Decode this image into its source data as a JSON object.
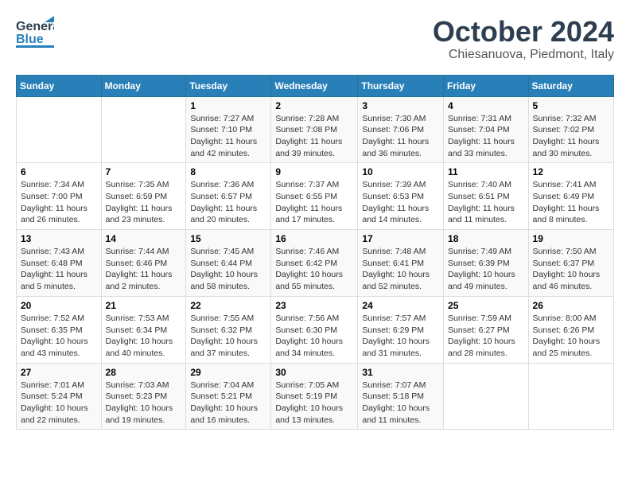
{
  "header": {
    "logo_general": "General",
    "logo_blue": "Blue",
    "month": "October 2024",
    "location": "Chiesanuova, Piedmont, Italy"
  },
  "weekdays": [
    "Sunday",
    "Monday",
    "Tuesday",
    "Wednesday",
    "Thursday",
    "Friday",
    "Saturday"
  ],
  "weeks": [
    [
      {
        "day": "",
        "sunrise": "",
        "sunset": "",
        "daylight": ""
      },
      {
        "day": "",
        "sunrise": "",
        "sunset": "",
        "daylight": ""
      },
      {
        "day": "1",
        "sunrise": "Sunrise: 7:27 AM",
        "sunset": "Sunset: 7:10 PM",
        "daylight": "Daylight: 11 hours and 42 minutes."
      },
      {
        "day": "2",
        "sunrise": "Sunrise: 7:28 AM",
        "sunset": "Sunset: 7:08 PM",
        "daylight": "Daylight: 11 hours and 39 minutes."
      },
      {
        "day": "3",
        "sunrise": "Sunrise: 7:30 AM",
        "sunset": "Sunset: 7:06 PM",
        "daylight": "Daylight: 11 hours and 36 minutes."
      },
      {
        "day": "4",
        "sunrise": "Sunrise: 7:31 AM",
        "sunset": "Sunset: 7:04 PM",
        "daylight": "Daylight: 11 hours and 33 minutes."
      },
      {
        "day": "5",
        "sunrise": "Sunrise: 7:32 AM",
        "sunset": "Sunset: 7:02 PM",
        "daylight": "Daylight: 11 hours and 30 minutes."
      }
    ],
    [
      {
        "day": "6",
        "sunrise": "Sunrise: 7:34 AM",
        "sunset": "Sunset: 7:00 PM",
        "daylight": "Daylight: 11 hours and 26 minutes."
      },
      {
        "day": "7",
        "sunrise": "Sunrise: 7:35 AM",
        "sunset": "Sunset: 6:59 PM",
        "daylight": "Daylight: 11 hours and 23 minutes."
      },
      {
        "day": "8",
        "sunrise": "Sunrise: 7:36 AM",
        "sunset": "Sunset: 6:57 PM",
        "daylight": "Daylight: 11 hours and 20 minutes."
      },
      {
        "day": "9",
        "sunrise": "Sunrise: 7:37 AM",
        "sunset": "Sunset: 6:55 PM",
        "daylight": "Daylight: 11 hours and 17 minutes."
      },
      {
        "day": "10",
        "sunrise": "Sunrise: 7:39 AM",
        "sunset": "Sunset: 6:53 PM",
        "daylight": "Daylight: 11 hours and 14 minutes."
      },
      {
        "day": "11",
        "sunrise": "Sunrise: 7:40 AM",
        "sunset": "Sunset: 6:51 PM",
        "daylight": "Daylight: 11 hours and 11 minutes."
      },
      {
        "day": "12",
        "sunrise": "Sunrise: 7:41 AM",
        "sunset": "Sunset: 6:49 PM",
        "daylight": "Daylight: 11 hours and 8 minutes."
      }
    ],
    [
      {
        "day": "13",
        "sunrise": "Sunrise: 7:43 AM",
        "sunset": "Sunset: 6:48 PM",
        "daylight": "Daylight: 11 hours and 5 minutes."
      },
      {
        "day": "14",
        "sunrise": "Sunrise: 7:44 AM",
        "sunset": "Sunset: 6:46 PM",
        "daylight": "Daylight: 11 hours and 2 minutes."
      },
      {
        "day": "15",
        "sunrise": "Sunrise: 7:45 AM",
        "sunset": "Sunset: 6:44 PM",
        "daylight": "Daylight: 10 hours and 58 minutes."
      },
      {
        "day": "16",
        "sunrise": "Sunrise: 7:46 AM",
        "sunset": "Sunset: 6:42 PM",
        "daylight": "Daylight: 10 hours and 55 minutes."
      },
      {
        "day": "17",
        "sunrise": "Sunrise: 7:48 AM",
        "sunset": "Sunset: 6:41 PM",
        "daylight": "Daylight: 10 hours and 52 minutes."
      },
      {
        "day": "18",
        "sunrise": "Sunrise: 7:49 AM",
        "sunset": "Sunset: 6:39 PM",
        "daylight": "Daylight: 10 hours and 49 minutes."
      },
      {
        "day": "19",
        "sunrise": "Sunrise: 7:50 AM",
        "sunset": "Sunset: 6:37 PM",
        "daylight": "Daylight: 10 hours and 46 minutes."
      }
    ],
    [
      {
        "day": "20",
        "sunrise": "Sunrise: 7:52 AM",
        "sunset": "Sunset: 6:35 PM",
        "daylight": "Daylight: 10 hours and 43 minutes."
      },
      {
        "day": "21",
        "sunrise": "Sunrise: 7:53 AM",
        "sunset": "Sunset: 6:34 PM",
        "daylight": "Daylight: 10 hours and 40 minutes."
      },
      {
        "day": "22",
        "sunrise": "Sunrise: 7:55 AM",
        "sunset": "Sunset: 6:32 PM",
        "daylight": "Daylight: 10 hours and 37 minutes."
      },
      {
        "day": "23",
        "sunrise": "Sunrise: 7:56 AM",
        "sunset": "Sunset: 6:30 PM",
        "daylight": "Daylight: 10 hours and 34 minutes."
      },
      {
        "day": "24",
        "sunrise": "Sunrise: 7:57 AM",
        "sunset": "Sunset: 6:29 PM",
        "daylight": "Daylight: 10 hours and 31 minutes."
      },
      {
        "day": "25",
        "sunrise": "Sunrise: 7:59 AM",
        "sunset": "Sunset: 6:27 PM",
        "daylight": "Daylight: 10 hours and 28 minutes."
      },
      {
        "day": "26",
        "sunrise": "Sunrise: 8:00 AM",
        "sunset": "Sunset: 6:26 PM",
        "daylight": "Daylight: 10 hours and 25 minutes."
      }
    ],
    [
      {
        "day": "27",
        "sunrise": "Sunrise: 7:01 AM",
        "sunset": "Sunset: 5:24 PM",
        "daylight": "Daylight: 10 hours and 22 minutes."
      },
      {
        "day": "28",
        "sunrise": "Sunrise: 7:03 AM",
        "sunset": "Sunset: 5:23 PM",
        "daylight": "Daylight: 10 hours and 19 minutes."
      },
      {
        "day": "29",
        "sunrise": "Sunrise: 7:04 AM",
        "sunset": "Sunset: 5:21 PM",
        "daylight": "Daylight: 10 hours and 16 minutes."
      },
      {
        "day": "30",
        "sunrise": "Sunrise: 7:05 AM",
        "sunset": "Sunset: 5:19 PM",
        "daylight": "Daylight: 10 hours and 13 minutes."
      },
      {
        "day": "31",
        "sunrise": "Sunrise: 7:07 AM",
        "sunset": "Sunset: 5:18 PM",
        "daylight": "Daylight: 10 hours and 11 minutes."
      },
      {
        "day": "",
        "sunrise": "",
        "sunset": "",
        "daylight": ""
      },
      {
        "day": "",
        "sunrise": "",
        "sunset": "",
        "daylight": ""
      }
    ]
  ]
}
